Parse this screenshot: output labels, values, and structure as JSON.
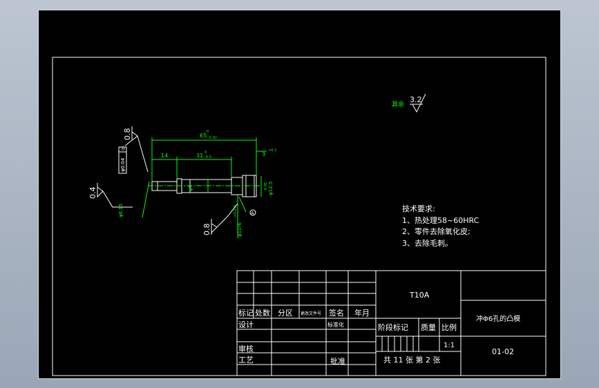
{
  "colors": {
    "background": "#000000",
    "lines": "#ffffff",
    "dimension": "#00ff00"
  },
  "roughness": {
    "other_label": "其余",
    "other_value": "3.2",
    "top_value": "0.8",
    "left_value": "0.4",
    "bottom_value": "0.8"
  },
  "dimensions": {
    "overall": "65",
    "overall_tol": "-0.02",
    "overall_sup": "0",
    "step_left": "14",
    "mid": "31",
    "mid_tol": "-0.3",
    "mid_sup": "0",
    "right_small": "3",
    "right_small_sup": "+0.1",
    "head_dia": "φ12.5",
    "head_tol": "-0.05",
    "mid_dia": "φ9",
    "tip_dia": "φ6.15",
    "body_dia": "φ11r6",
    "body_tol": "+0.035",
    "flat": "φ0.04",
    "datum": "A",
    "box_symbol": "◎"
  },
  "requirements": {
    "title": "技术要求:",
    "items": [
      "1、热处理58~60HRC",
      "2、零件去除氧化皮;",
      "3、去除毛刺。"
    ]
  },
  "title_block": {
    "material": "T10A",
    "part_name": "冲Φ6孔的凸模",
    "drawing_no": "01-02",
    "marks_label": "标记",
    "count_label": "处数",
    "zone_label": "分区",
    "change_doc_label": "更改文件号",
    "signature_label": "签名",
    "date_label": "年月",
    "design_label": "设计",
    "standard_label": "标准化",
    "stage_label": "阶段标记",
    "weight_label": "质量",
    "scale_label": "比例",
    "scale_value": "1:1",
    "review_label": "审核",
    "process_label": "工艺",
    "approve_label": "批准",
    "sheets_text": "共 11 张 第 2 张"
  }
}
